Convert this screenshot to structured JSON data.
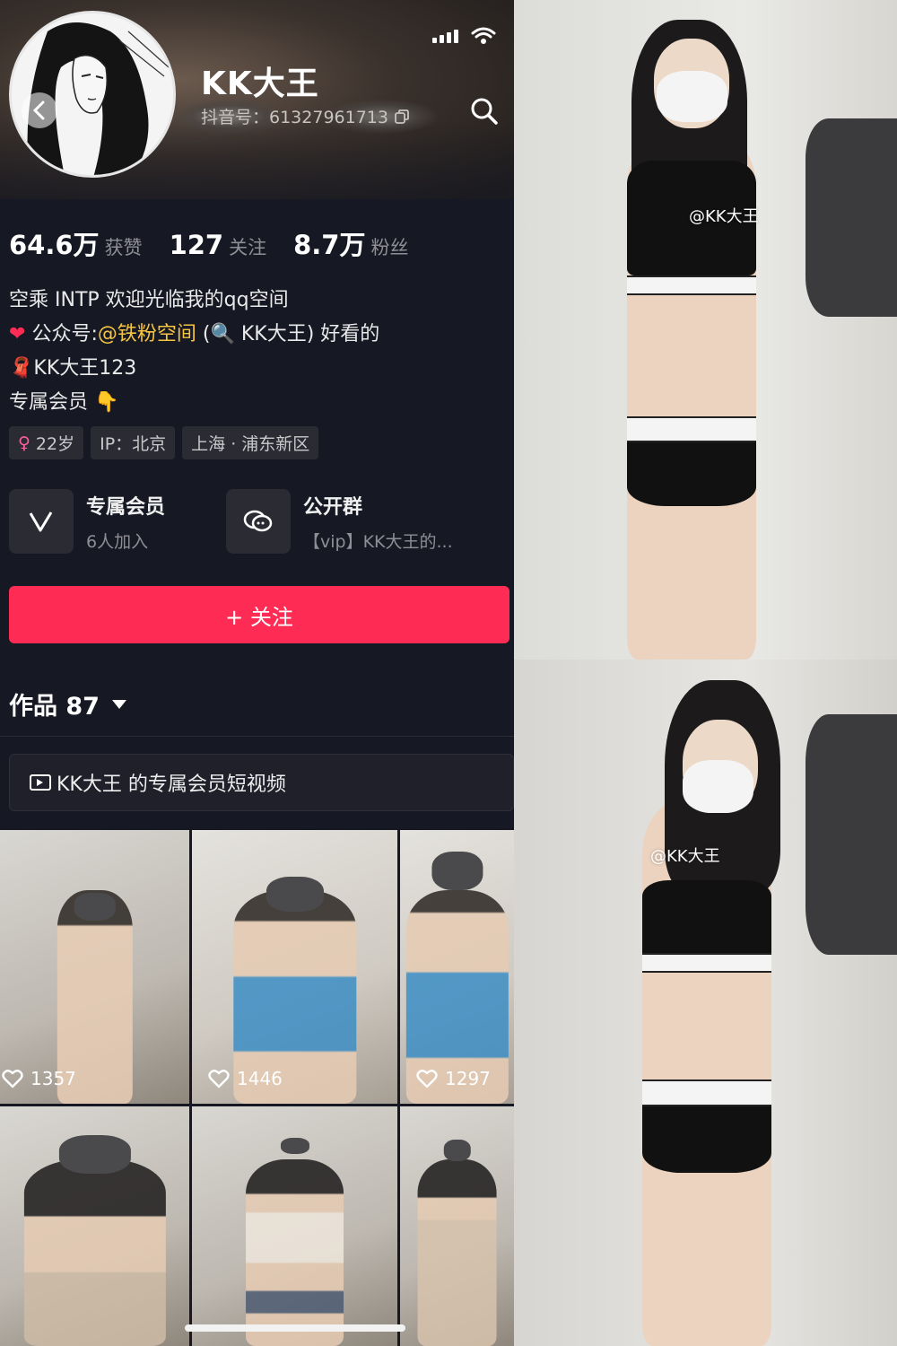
{
  "profile": {
    "name": "KK大王",
    "account": "抖音号：61327961713",
    "stats": [
      {
        "value": "64.6万",
        "label": "获赞"
      },
      {
        "value": "127",
        "label": "关注"
      },
      {
        "value": "8.7万",
        "label": "粉丝"
      }
    ],
    "bio": {
      "line1": "空乘 INTP 欢迎光临我的qq空间",
      "line2_prefix": "公众号:",
      "line2_link": "@铁粉空间",
      "line2_suffix": "KK大王) 好看的",
      "line2_paren": "(",
      "line3": "KK大王123",
      "line4": "专属会员"
    },
    "tags": {
      "age": "22岁",
      "ip": "IP：北京",
      "location": "上海 · 浦东新区"
    },
    "cards": {
      "member_title": "专属会员",
      "member_sub": "6人加入",
      "group_title": "公开群",
      "group_sub": "【vip】KK大王的..."
    },
    "follow_button": "+ 关注",
    "works_label": "作品 87",
    "vip_videos": "KK大王 的专属会员短视频"
  },
  "thumbnails": [
    {
      "likes": "1357"
    },
    {
      "likes": "1446"
    },
    {
      "likes": "1297"
    }
  ],
  "photos": {
    "watermark_top": "@KK大王",
    "watermark_bottom": "@KK大王"
  },
  "colors": {
    "background": "#161823",
    "follow_button": "#fe2c55",
    "link_yellow": "#f5c542",
    "tag_bg": "#2a2b33"
  }
}
